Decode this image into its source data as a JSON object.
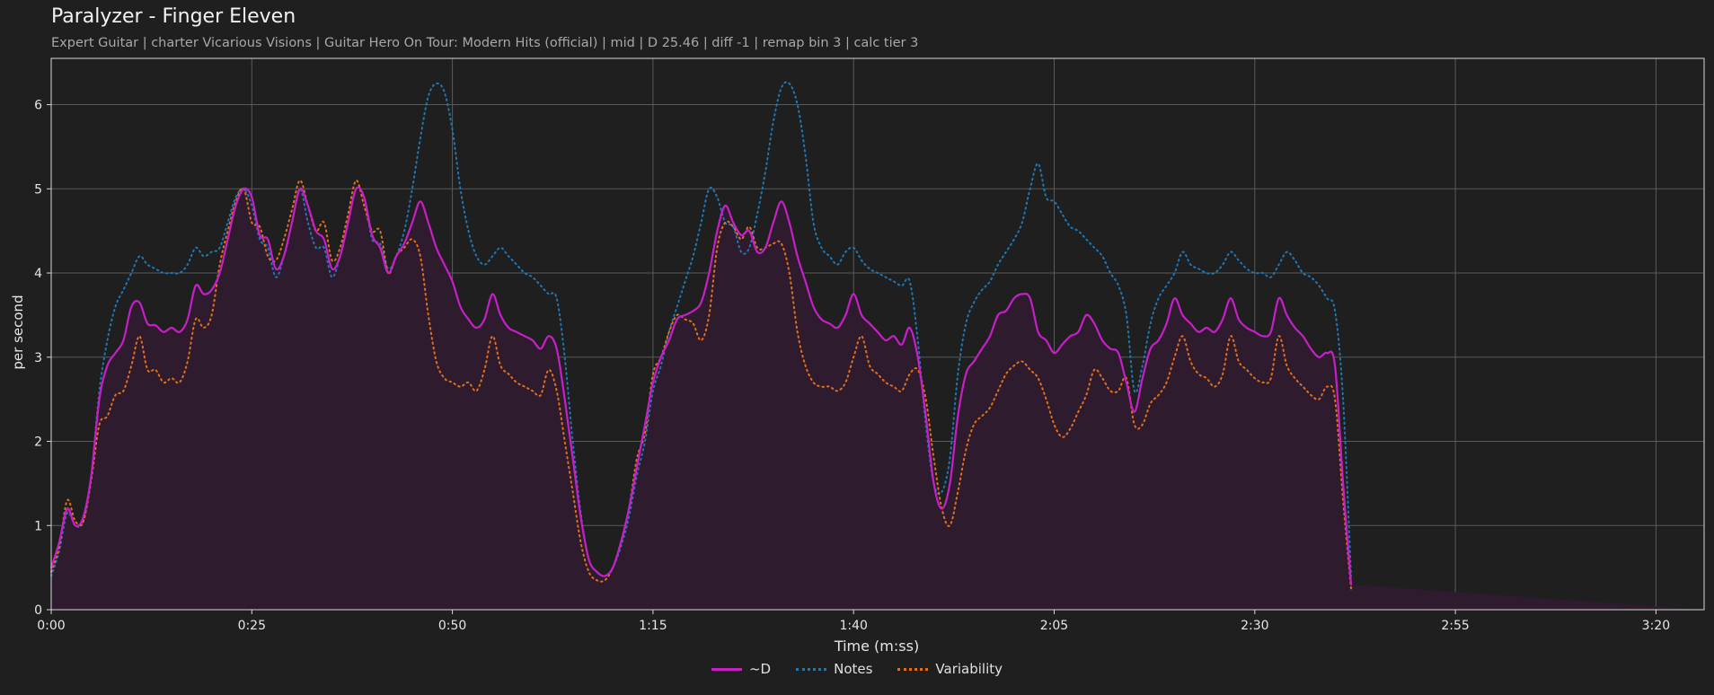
{
  "title": "Paralyzer - Finger Eleven",
  "subtitle": "Expert Guitar  |  charter Vicarious Visions  |  Guitar Hero On Tour: Modern Hits (official)  |  mid  |  D 25.46  |  diff -1  |  remap bin 3  |  calc tier 3",
  "colors": {
    "background": "#1f1f1f",
    "d": "#c71fc7",
    "d_fill": "#2e1c2e",
    "notes": "#1f77b4",
    "variability": "#e0701c",
    "grid": "#5a5a5a"
  },
  "chart_data": {
    "type": "line",
    "xlabel": "Time (m:ss)",
    "ylabel": "per second",
    "xlim": [
      0,
      206
    ],
    "ylim": [
      0,
      6.55
    ],
    "xticks": [
      0,
      25,
      50,
      75,
      100,
      125,
      150,
      175,
      200
    ],
    "xtick_labels": [
      "0:00",
      "0:25",
      "0:50",
      "1:15",
      "1:40",
      "2:05",
      "2:30",
      "2:55",
      "3:20"
    ],
    "yticks": [
      0,
      1,
      2,
      3,
      4,
      5,
      6
    ],
    "grid": true,
    "legend_position": "bottom-center",
    "x": [
      0,
      1,
      2,
      3,
      4,
      5,
      6,
      7,
      8,
      9,
      10,
      11,
      12,
      13,
      14,
      15,
      16,
      17,
      18,
      19,
      20,
      21,
      22,
      23,
      24,
      25,
      26,
      27,
      28,
      29,
      30,
      31,
      32,
      33,
      34,
      35,
      36,
      37,
      38,
      39,
      40,
      41,
      42,
      43,
      44,
      45,
      46,
      47,
      48,
      49,
      50,
      51,
      52,
      53,
      54,
      55,
      56,
      57,
      58,
      59,
      60,
      61,
      62,
      63,
      64,
      65,
      66,
      67,
      68,
      69,
      70,
      71,
      72,
      73,
      74,
      75,
      76,
      77,
      78,
      79,
      80,
      81,
      82,
      83,
      84,
      85,
      86,
      87,
      88,
      89,
      90,
      91,
      92,
      93,
      94,
      95,
      96,
      97,
      98,
      99,
      100,
      101,
      102,
      103,
      104,
      105,
      106,
      107,
      108,
      109,
      110,
      111,
      112,
      113,
      114,
      115,
      116,
      117,
      118,
      119,
      120,
      121,
      122,
      123,
      124,
      125,
      126,
      127,
      128,
      129,
      130,
      131,
      132,
      133,
      134,
      135,
      136,
      137,
      138,
      139,
      140,
      141,
      142,
      143,
      144,
      145,
      146,
      147,
      148,
      149,
      150,
      151,
      152,
      153,
      154,
      155,
      156,
      157,
      158,
      159,
      160,
      161,
      162,
      163,
      164,
      165,
      166,
      167,
      168,
      169,
      170,
      171,
      172,
      173,
      174,
      175,
      176,
      177,
      178,
      179,
      180,
      181,
      182,
      183,
      184,
      185,
      186,
      187,
      188,
      189,
      190,
      191,
      192,
      193,
      194,
      195,
      196,
      197,
      198,
      199,
      200,
      201,
      202,
      203,
      204,
      205,
      206
    ],
    "series": [
      {
        "name": "~D",
        "values": [
          0.5,
          0.8,
          1.2,
          1.0,
          1.1,
          1.6,
          2.5,
          2.9,
          3.05,
          3.2,
          3.6,
          3.65,
          3.4,
          3.38,
          3.3,
          3.35,
          3.3,
          3.45,
          3.85,
          3.75,
          3.8,
          4.0,
          4.4,
          4.8,
          5.0,
          4.9,
          4.45,
          4.4,
          4.05,
          4.2,
          4.6,
          5.0,
          4.8,
          4.5,
          4.4,
          4.05,
          4.2,
          4.6,
          5.0,
          4.9,
          4.45,
          4.3,
          4.0,
          4.2,
          4.35,
          4.6,
          4.85,
          4.6,
          4.3,
          4.1,
          3.9,
          3.6,
          3.45,
          3.35,
          3.45,
          3.75,
          3.5,
          3.35,
          3.3,
          3.25,
          3.2,
          3.1,
          3.25,
          3.1,
          2.5,
          1.8,
          1.1,
          0.6,
          0.45,
          0.4,
          0.5,
          0.8,
          1.2,
          1.7,
          2.2,
          2.7,
          3.0,
          3.2,
          3.45,
          3.5,
          3.55,
          3.65,
          4.0,
          4.5,
          4.8,
          4.6,
          4.45,
          4.5,
          4.25,
          4.3,
          4.6,
          4.85,
          4.6,
          4.2,
          3.9,
          3.6,
          3.45,
          3.4,
          3.35,
          3.5,
          3.75,
          3.5,
          3.4,
          3.3,
          3.2,
          3.25,
          3.15,
          3.35,
          3.0,
          2.3,
          1.5,
          1.2,
          1.5,
          2.3,
          2.8,
          2.95,
          3.1,
          3.25,
          3.5,
          3.55,
          3.7,
          3.75,
          3.7,
          3.3,
          3.2,
          3.05,
          3.15,
          3.25,
          3.3,
          3.5,
          3.4,
          3.2,
          3.1,
          3.05,
          2.7,
          2.35,
          2.75,
          3.1,
          3.2,
          3.4,
          3.7,
          3.5,
          3.4,
          3.3,
          3.35,
          3.3,
          3.45,
          3.7,
          3.45,
          3.35,
          3.3,
          3.25,
          3.3,
          3.7,
          3.5,
          3.35,
          3.25,
          3.1,
          3.0,
          3.05,
          2.9,
          1.5,
          0.3
        ]
      },
      {
        "name": "Notes",
        "values": [
          0.4,
          0.7,
          1.15,
          1.0,
          1.05,
          1.6,
          2.6,
          3.2,
          3.6,
          3.8,
          4.0,
          4.2,
          4.1,
          4.05,
          4.0,
          4.0,
          4.0,
          4.1,
          4.3,
          4.2,
          4.25,
          4.3,
          4.6,
          4.9,
          5.0,
          4.8,
          4.4,
          4.3,
          3.95,
          4.2,
          4.6,
          5.0,
          4.6,
          4.3,
          4.3,
          3.95,
          4.2,
          4.6,
          5.0,
          4.9,
          4.4,
          4.35,
          4.05,
          4.2,
          4.5,
          5.0,
          5.6,
          6.1,
          6.25,
          6.15,
          5.7,
          5.0,
          4.5,
          4.2,
          4.1,
          4.2,
          4.3,
          4.2,
          4.1,
          4.0,
          3.95,
          3.85,
          3.75,
          3.7,
          3.0,
          2.0,
          1.15,
          0.6,
          0.45,
          0.4,
          0.5,
          0.75,
          1.1,
          1.6,
          2.0,
          2.6,
          2.9,
          3.3,
          3.6,
          3.9,
          4.2,
          4.6,
          5.0,
          4.9,
          4.6,
          4.55,
          4.25,
          4.3,
          4.7,
          5.2,
          5.8,
          6.2,
          6.25,
          6.0,
          5.4,
          4.6,
          4.3,
          4.2,
          4.1,
          4.25,
          4.3,
          4.15,
          4.05,
          4.0,
          3.95,
          3.9,
          3.85,
          3.9,
          3.2,
          2.2,
          1.5,
          1.4,
          1.8,
          2.8,
          3.4,
          3.65,
          3.8,
          3.9,
          4.1,
          4.25,
          4.4,
          4.6,
          5.0,
          5.3,
          4.9,
          4.85,
          4.7,
          4.55,
          4.5,
          4.4,
          4.3,
          4.2,
          4.0,
          3.85,
          3.5,
          2.6,
          2.9,
          3.4,
          3.7,
          3.85,
          4.0,
          4.25,
          4.1,
          4.05,
          4.0,
          4.0,
          4.1,
          4.25,
          4.15,
          4.05,
          4.0,
          4.0,
          3.95,
          4.1,
          4.25,
          4.15,
          4.0,
          3.95,
          3.85,
          3.7,
          3.55,
          2.5,
          0.4
        ]
      },
      {
        "name": "Variability",
        "values": [
          0.45,
          0.75,
          1.3,
          1.05,
          1.05,
          1.55,
          2.2,
          2.3,
          2.55,
          2.6,
          2.9,
          3.25,
          2.85,
          2.85,
          2.7,
          2.75,
          2.7,
          2.95,
          3.45,
          3.35,
          3.5,
          4.1,
          4.5,
          4.85,
          5.0,
          4.6,
          4.55,
          4.2,
          4.15,
          4.4,
          4.75,
          5.1,
          4.8,
          4.5,
          4.6,
          4.15,
          4.3,
          4.7,
          5.1,
          4.8,
          4.5,
          4.5,
          4.0,
          4.2,
          4.3,
          4.4,
          4.2,
          3.5,
          2.95,
          2.75,
          2.7,
          2.65,
          2.7,
          2.6,
          2.85,
          3.25,
          2.9,
          2.8,
          2.7,
          2.65,
          2.6,
          2.55,
          2.85,
          2.6,
          2.0,
          1.4,
          0.8,
          0.45,
          0.35,
          0.35,
          0.5,
          0.8,
          1.2,
          1.8,
          2.1,
          2.8,
          3.0,
          3.3,
          3.5,
          3.45,
          3.4,
          3.2,
          3.5,
          4.3,
          4.6,
          4.55,
          4.4,
          4.55,
          4.3,
          4.3,
          4.35,
          4.35,
          4.0,
          3.3,
          2.9,
          2.7,
          2.65,
          2.65,
          2.6,
          2.7,
          3.0,
          3.25,
          2.9,
          2.8,
          2.7,
          2.65,
          2.6,
          2.8,
          2.85,
          2.5,
          1.8,
          1.2,
          1.0,
          1.4,
          1.9,
          2.2,
          2.3,
          2.4,
          2.6,
          2.8,
          2.9,
          2.95,
          2.85,
          2.75,
          2.5,
          2.2,
          2.05,
          2.15,
          2.35,
          2.55,
          2.85,
          2.75,
          2.6,
          2.6,
          2.75,
          2.2,
          2.2,
          2.45,
          2.55,
          2.7,
          3.0,
          3.25,
          2.95,
          2.8,
          2.75,
          2.65,
          2.8,
          3.25,
          2.95,
          2.85,
          2.75,
          2.7,
          2.75,
          3.25,
          2.9,
          2.75,
          2.65,
          2.55,
          2.5,
          2.65,
          2.5,
          1.3,
          0.25
        ]
      }
    ]
  }
}
